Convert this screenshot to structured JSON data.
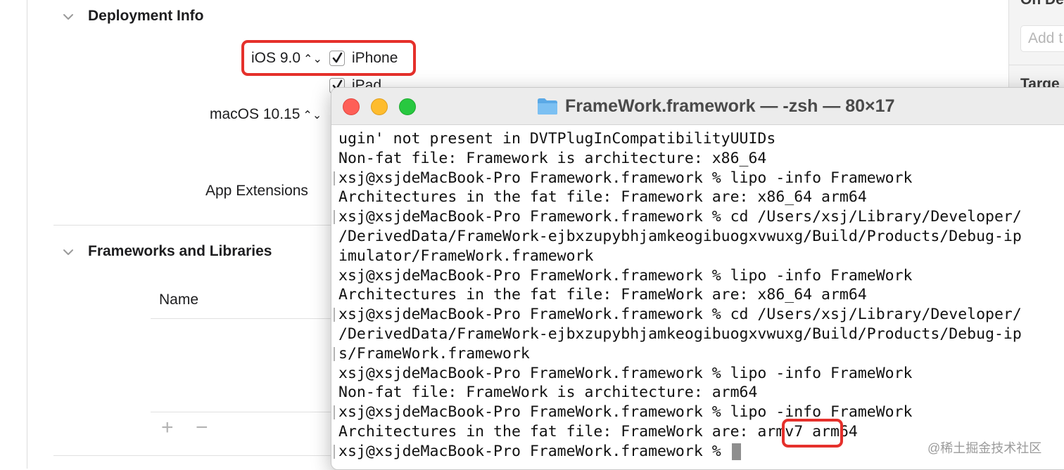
{
  "deployment": {
    "title": "Deployment Info",
    "ios_version": "iOS 9.0",
    "stepper_glyph": "⌃⌄",
    "iphone_label": "iPhone",
    "ipad_label": "iPad",
    "macos_version": "macOS 10.15",
    "app_extensions_label": "App Extensions"
  },
  "frameworks": {
    "title": "Frameworks and Libraries",
    "column_name": "Name",
    "add_symbol": "+",
    "remove_symbol": "−"
  },
  "right_panel": {
    "title_partial": "On De",
    "add_placeholder": "Add t",
    "partial_heading": "Targe"
  },
  "terminal": {
    "title": "FrameWork.framework — -zsh — 80×17",
    "lines": [
      "ugin' not present in DVTPlugInCompatibilityUUIDs",
      "Non-fat file: Framework is architecture: x86_64",
      "xsj@xsjdeMacBook-Pro Framework.framework % lipo -info Framework",
      "Architectures in the fat file: Framework are: x86_64 arm64",
      "xsj@xsjdeMacBook-Pro Framework.framework % cd /Users/xsj/Library/Developer/",
      "/DerivedData/FrameWork-ejbxzupybhjamkeogibuogxvwuxg/Build/Products/Debug-ip",
      "imulator/FrameWork.framework",
      "xsj@xsjdeMacBook-Pro FrameWork.framework % lipo -info FrameWork",
      "Architectures in the fat file: FrameWork are: x86_64 arm64",
      "xsj@xsjdeMacBook-Pro FrameWork.framework % cd /Users/xsj/Library/Developer/",
      "/DerivedData/FrameWork-ejbxzupybhjamkeogibuogxvwuxg/Build/Products/Debug-ip",
      "s/FrameWork.framework",
      "xsj@xsjdeMacBook-Pro FrameWork.framework % lipo -info FrameWork",
      "Non-fat file: FrameWork is architecture: arm64",
      "xsj@xsjdeMacBook-Pro FrameWork.framework % lipo -info FrameWork",
      "Architectures in the fat file: FrameWork are: armv7 arm64",
      "xsj@xsjdeMacBook-Pro FrameWork.framework % "
    ]
  },
  "watermark": "@稀土掘金技术社区",
  "colors": {
    "highlight": "#e5302b",
    "traffic_red": "#fe5f57",
    "traffic_yellow": "#febc2e",
    "traffic_green": "#28c840"
  },
  "icons": {
    "section_toggle": "chevron-down-icon",
    "checkbox": "checkmark-icon",
    "terminal_title": "folder-icon"
  }
}
